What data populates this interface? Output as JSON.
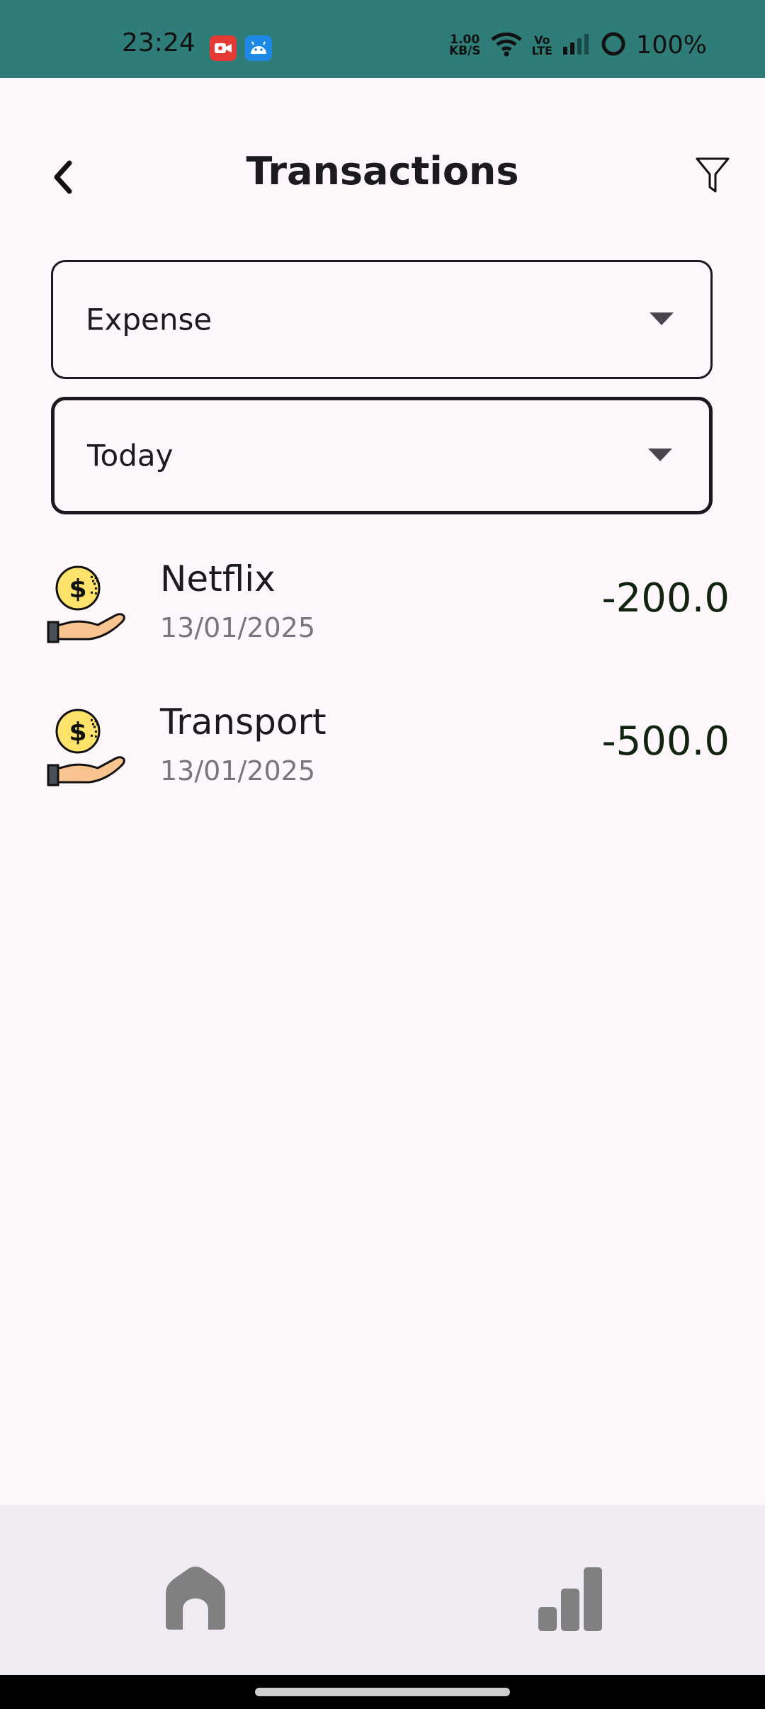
{
  "status_bar": {
    "time": "23:24",
    "net_speed_value": "1.00",
    "net_speed_unit": "KB/S",
    "volte_top": "Vo",
    "volte_bottom": "LTE",
    "battery": "100%",
    "colors": {
      "background": "#2f7d78"
    },
    "icons": [
      "screen-record-icon",
      "android-icon",
      "wifi-icon",
      "signal-icon",
      "battery-icon"
    ]
  },
  "header": {
    "title": "Transactions",
    "back_icon": "chevron-left-icon",
    "filter_icon": "filter-icon"
  },
  "filters": {
    "type": {
      "selected": "Expense"
    },
    "period": {
      "selected": "Today"
    }
  },
  "transactions": [
    {
      "name": "Netflix",
      "date": "13/01/2025",
      "amount": "-200.0",
      "icon": "coin-hand-icon"
    },
    {
      "name": "Transport",
      "date": "13/01/2025",
      "amount": "-500.0",
      "icon": "coin-hand-icon"
    }
  ],
  "bottom_nav": {
    "items": [
      {
        "icon": "home-icon"
      },
      {
        "icon": "stats-icon"
      }
    ]
  },
  "colors": {
    "accent": "#2f7d78",
    "background": "#fdf7fc",
    "nav_background": "#f1ecf4",
    "amount_text": "#10240f"
  }
}
